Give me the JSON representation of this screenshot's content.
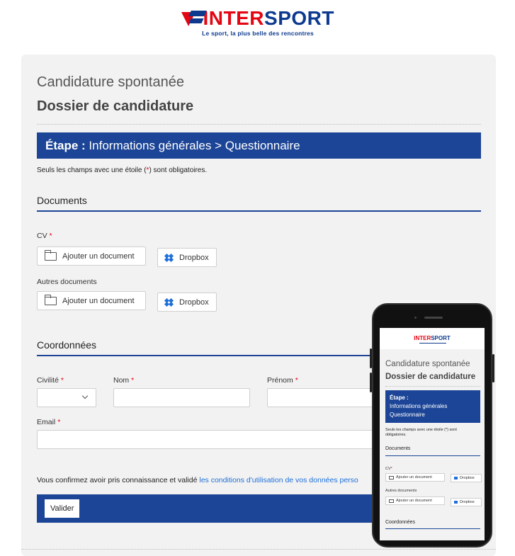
{
  "brand": {
    "name_part1": "INTER",
    "name_part2": "SPORT",
    "tagline": "Le sport, la plus belle des rencontres"
  },
  "form": {
    "title": "Candidature spontanée",
    "subtitle": "Dossier de candidature",
    "step_label": "Étape :",
    "step_text": "Informations générales > Questionnaire",
    "required_note_prefix": "Seuls les champs avec une étoile (",
    "required_note_star": "*",
    "required_note_suffix": ") sont obligatoires.",
    "documents_section": "Documents",
    "cv_label": "CV",
    "other_docs_label": "Autres documents",
    "add_document_label": "Ajouter un document",
    "dropbox_label": "Dropbox",
    "contact_section": "Coordonnées",
    "civility_label": "Civilité",
    "name_label": "Nom",
    "firstname_label": "Prénom",
    "email_label": "Email",
    "civility_value": "",
    "name_value": "",
    "firstname_value": "",
    "email_value": "",
    "consent_text": "Vous confirmez avoir pris connaissance et validé ",
    "consent_link": "les conditions d'utilisation de vos données perso",
    "submit_label": "Valider",
    "required_star": "*"
  },
  "mobile": {
    "logo_part1": "INTER",
    "logo_part2": "SPORT",
    "title": "Candidature spontanée",
    "subtitle": "Dossier de candidature",
    "step_label": "Étape :",
    "step_line1": "Informations générales",
    "step_line2": "Questionnaire",
    "required_note": "Seuls les champs avec une étoile (*) sont obligatoires.",
    "documents_section": "Documents",
    "cv_label": "CV",
    "other_docs_label": "Autres documents",
    "add_document_label": "Ajouter un document",
    "dropbox_label": "Dropbox",
    "contact_section": "Coordonnées"
  },
  "colors": {
    "brand_red": "#e30613",
    "brand_blue": "#0d3a8f",
    "bar_blue": "#1c4597",
    "link_blue": "#1e6fd9",
    "panel_bg": "#f2f2f2"
  }
}
